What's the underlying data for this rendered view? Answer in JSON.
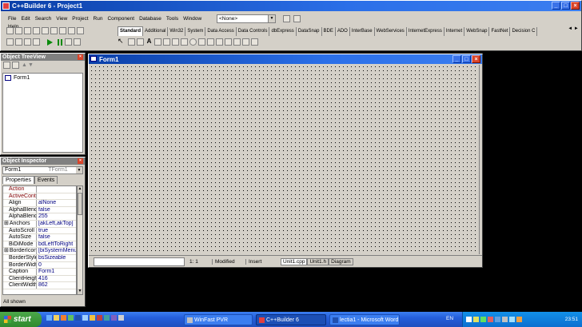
{
  "main_window": {
    "title": "C++Builder 6 - Project1",
    "menu": [
      "File",
      "Edit",
      "Search",
      "View",
      "Project",
      "Run",
      "Component",
      "Database",
      "Tools",
      "Window",
      "Help"
    ],
    "config_combo": "<None>",
    "palette_tabs": [
      "Standard",
      "Additional",
      "Win32",
      "System",
      "Data Access",
      "Data Controls",
      "dbExpress",
      "DataSnap",
      "BDE",
      "ADO",
      "InterBase",
      "WebServices",
      "InternetExpress",
      "Internet",
      "WebSnap",
      "FastNet",
      "Decision C"
    ]
  },
  "object_treeview": {
    "title": "Object TreeView",
    "items": [
      "Form1"
    ]
  },
  "object_inspector": {
    "title": "Object Inspector",
    "selected_object": "Form1",
    "selected_type": "TForm1",
    "tabs": [
      "Properties",
      "Events"
    ],
    "properties": [
      {
        "name": "Action",
        "value": "",
        "kind": "event"
      },
      {
        "name": "ActiveControl",
        "value": "",
        "kind": "event"
      },
      {
        "name": "Align",
        "value": "alNone",
        "kind": "prop"
      },
      {
        "name": "AlphaBlend",
        "value": "false",
        "kind": "prop"
      },
      {
        "name": "AlphaBlendVal",
        "value": "255",
        "kind": "prop"
      },
      {
        "name": "Anchors",
        "value": "[akLeft,akTop]",
        "kind": "prop",
        "expand": "⊞"
      },
      {
        "name": "AutoScroll",
        "value": "true",
        "kind": "prop"
      },
      {
        "name": "AutoSize",
        "value": "false",
        "kind": "prop"
      },
      {
        "name": "BiDiMode",
        "value": "bdLeftToRight",
        "kind": "prop"
      },
      {
        "name": "BorderIcons",
        "value": "[biSystemMenu,",
        "kind": "prop",
        "expand": "⊞"
      },
      {
        "name": "BorderStyle",
        "value": "bsSizeable",
        "kind": "prop"
      },
      {
        "name": "BorderWidth",
        "value": "0",
        "kind": "prop"
      },
      {
        "name": "Caption",
        "value": "Form1",
        "kind": "prop"
      },
      {
        "name": "ClientHeight",
        "value": "416",
        "kind": "prop"
      },
      {
        "name": "ClientWidth",
        "value": "862",
        "kind": "prop"
      }
    ],
    "status": "All shown"
  },
  "form_designer": {
    "title": "Form1"
  },
  "editor_status": {
    "position": "1:   1",
    "state": "Modified",
    "mode": "Insert",
    "tabs": [
      "Unit1.cpp",
      "Unit1.h",
      "Diagram"
    ]
  },
  "taskbar": {
    "start_label": "start",
    "buttons": [
      {
        "label": "WinFast PVR",
        "active": false
      },
      {
        "label": "C++Builder 6",
        "active": true
      },
      {
        "label": "lectia1 - Microsoft Word",
        "active": false
      }
    ],
    "language": "EN",
    "clock": "23:51"
  }
}
